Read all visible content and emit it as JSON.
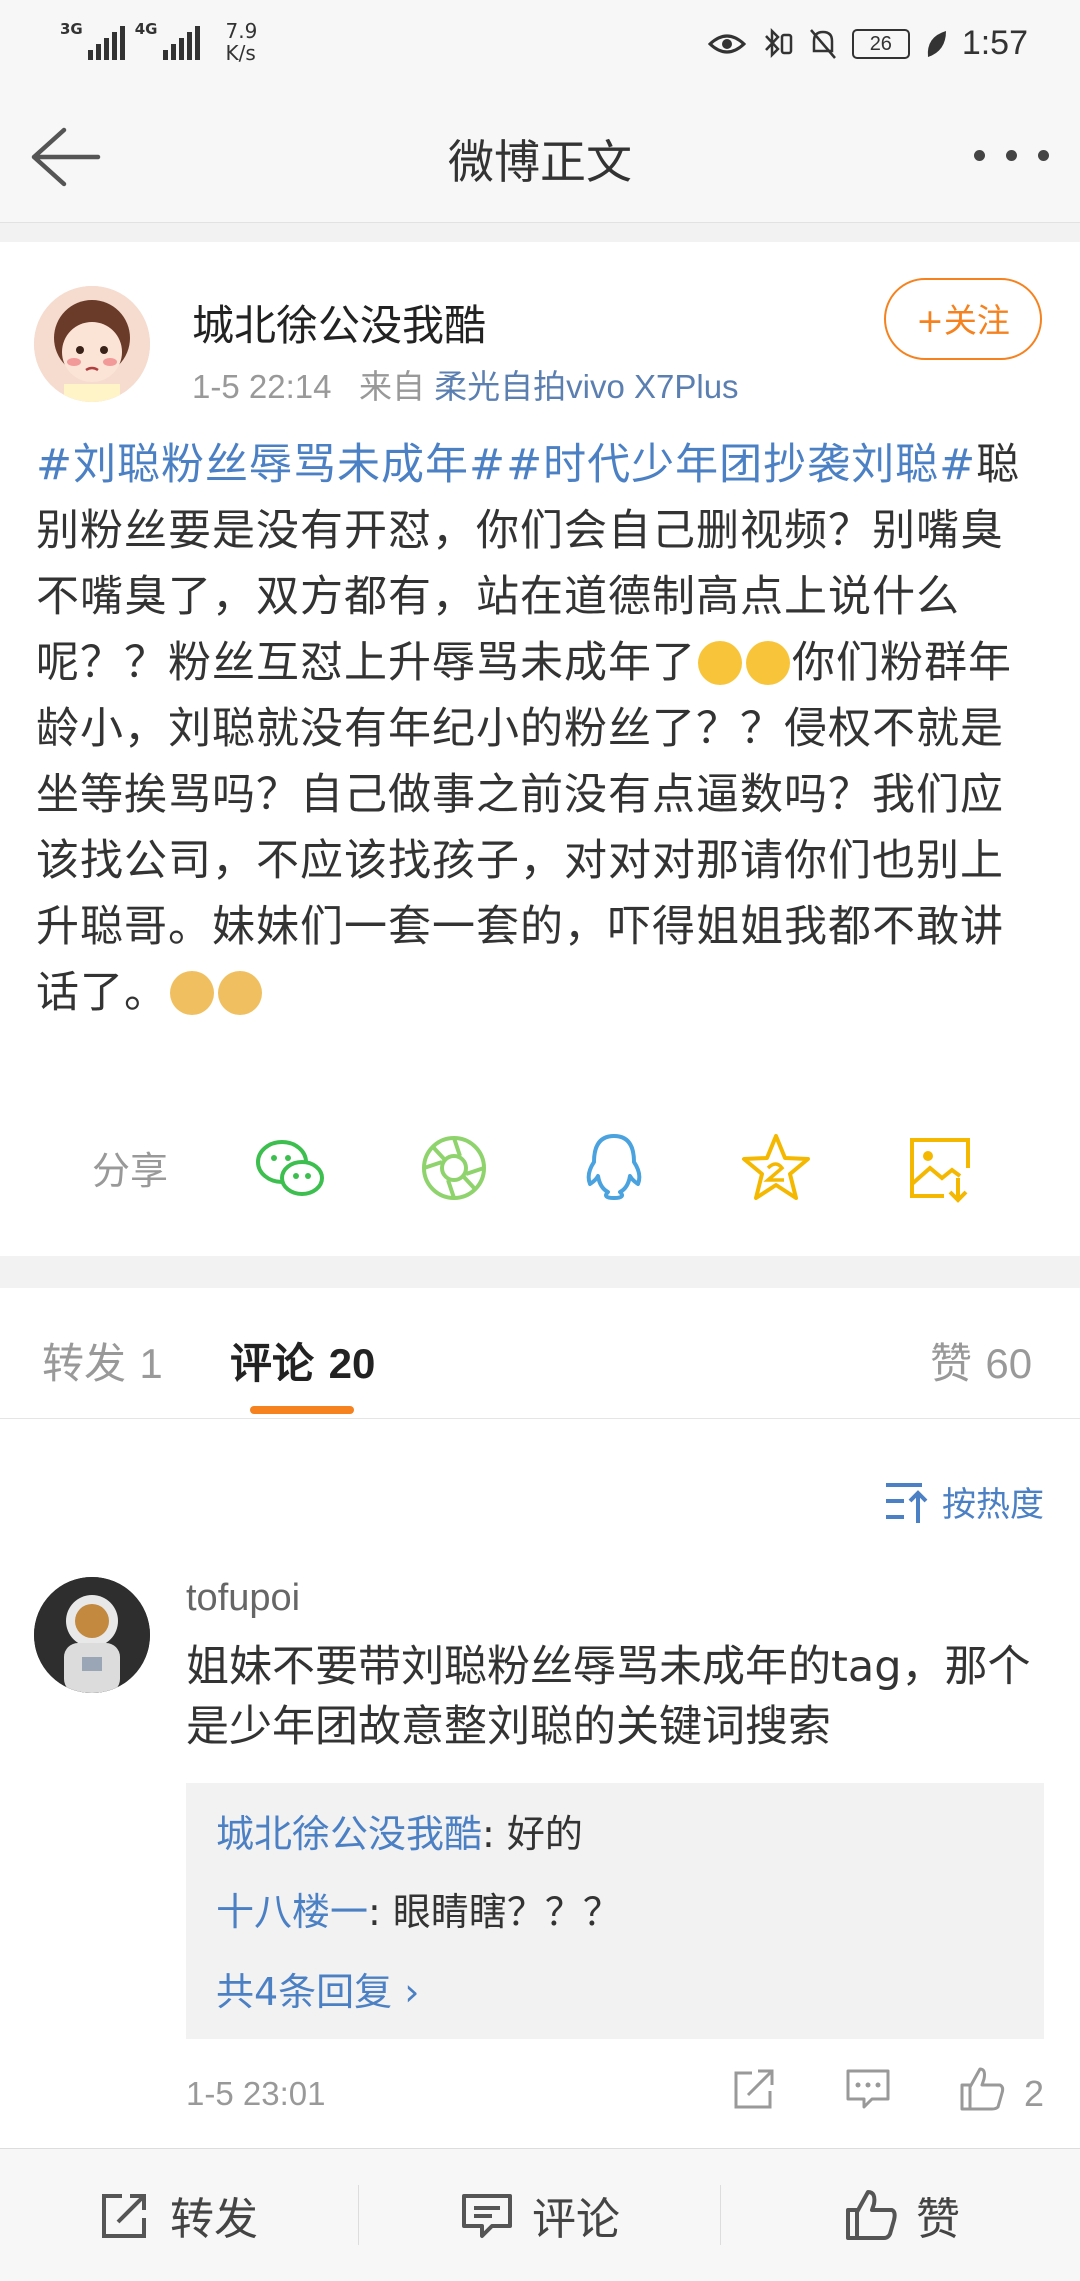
{
  "status_bar": {
    "signal1": "3G",
    "signal2": "4G",
    "net_speed_value": "7.9",
    "net_speed_unit": "K/s",
    "battery": "26",
    "time": "1:57"
  },
  "header": {
    "title": "微博正文"
  },
  "post": {
    "author": "城北徐公没我酷",
    "timestamp": "1-5 22:14",
    "source_prefix": "来自",
    "source": "柔光自拍vivo X7Plus",
    "follow_label": "+关注",
    "tag1": "#刘聪粉丝辱骂未成年#",
    "tag2": "#时代少年团抄袭刘聪#",
    "body_part1": "聪别粉丝要是没有开怼，你们会自己删视频？别嘴臭不嘴臭了，双方都有，站在道德制高点上说什么呢？？粉丝互怼上升辱骂未成年了",
    "body_part2": "你们粉群年龄小，刘聪就没有年纪小的粉丝了？？侵权不就是坐等挨骂吗？自己做事之前没有点逼数吗？我们应该找公司，不应该找孩子，对对对那请你们也别上升聪哥。妹妹们一套一套的，吓得姐姐我都不敢讲话了。",
    "share_label": "分享"
  },
  "tabs": {
    "repost_label": "转发",
    "repost_count": "1",
    "comment_label": "评论",
    "comment_count": "20",
    "like_label": "赞",
    "like_count": "60"
  },
  "comments": {
    "sort_label": "按热度",
    "items": [
      {
        "user": "tofupoi",
        "text": "姐妹不要带刘聪粉丝辱骂未成年的tag，那个是少年团故意整刘聪的关键词搜索",
        "replies": [
          {
            "name": "城北徐公没我酷",
            "text": ": 好的"
          },
          {
            "name": "十八楼一",
            "text": ": 眼睛瞎？？？"
          }
        ],
        "more_replies": "共4条回复 ›",
        "time": "1-5 23:01",
        "like_count": "2"
      }
    ]
  },
  "bottom_bar": {
    "repost": "转发",
    "comment": "评论",
    "like": "赞"
  },
  "colors": {
    "accent_orange": "#f5821f",
    "link_blue": "#4c80c4",
    "wechat_green": "#3cbf4e",
    "qq_blue": "#4aa3df",
    "star_yellow": "#f5b800"
  }
}
